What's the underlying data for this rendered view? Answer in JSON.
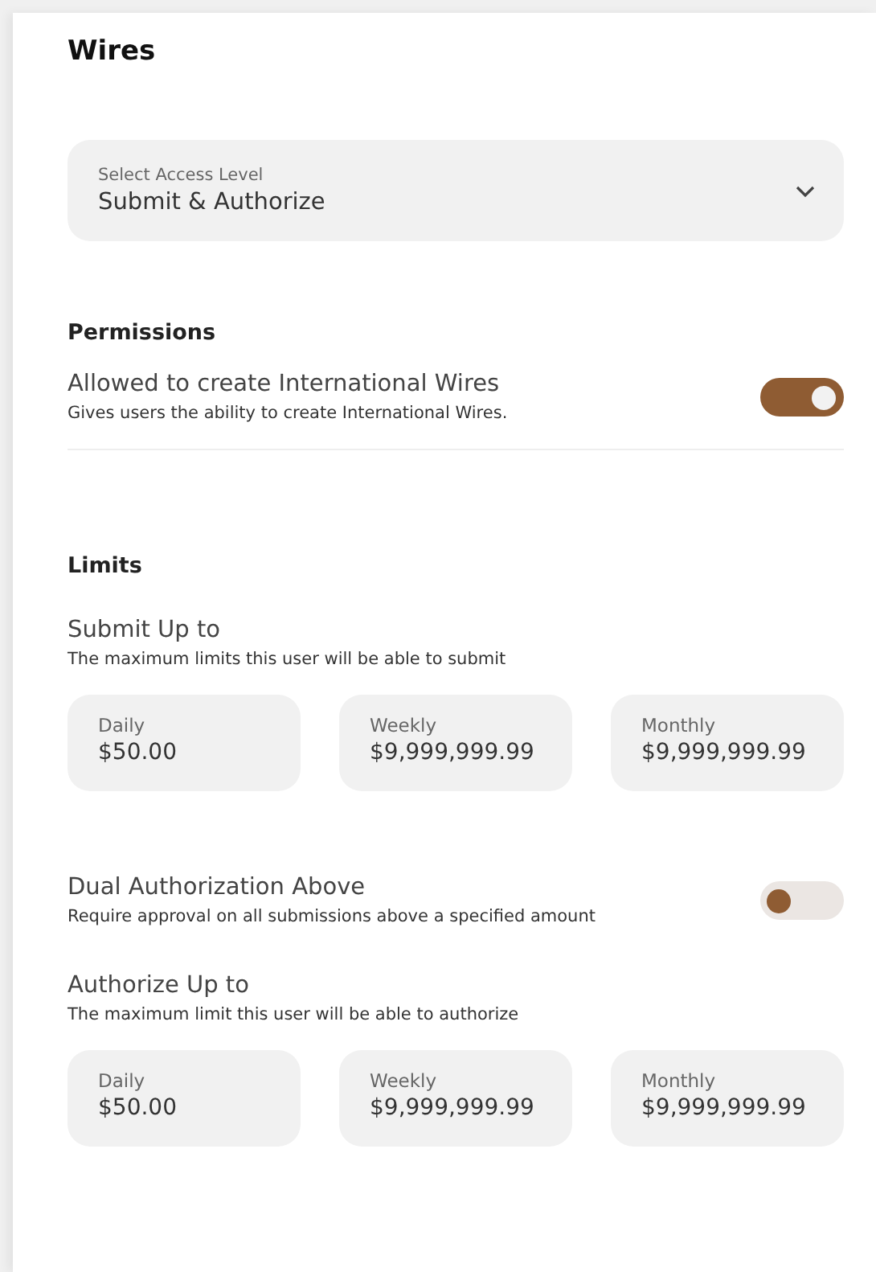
{
  "title": "Wires",
  "access_select": {
    "label": "Select Access Level",
    "value": "Submit & Authorize"
  },
  "permissions": {
    "heading": "Permissions",
    "items": [
      {
        "label": "Allowed to create International Wires",
        "description": "Gives users the ability to create International Wires.",
        "on": true
      }
    ]
  },
  "limits": {
    "heading": "Limits",
    "sections": [
      {
        "kind": "amounts",
        "title": "Submit Up to",
        "description": "The maximum limits this user will be able to submit",
        "fields": [
          {
            "label": "Daily",
            "value": "$50.00"
          },
          {
            "label": "Weekly",
            "value": "$9,999,999.99"
          },
          {
            "label": "Monthly",
            "value": "$9,999,999.99"
          }
        ]
      },
      {
        "kind": "toggle",
        "title": "Dual Authorization Above",
        "description": "Require approval on all submissions above a specified amount",
        "on": false
      },
      {
        "kind": "amounts",
        "title": "Authorize Up to",
        "description": "The maximum limit this user will be able to authorize",
        "fields": [
          {
            "label": "Daily",
            "value": "$50.00"
          },
          {
            "label": "Weekly",
            "value": "$9,999,999.99"
          },
          {
            "label": "Monthly",
            "value": "$9,999,999.99"
          }
        ]
      }
    ]
  }
}
